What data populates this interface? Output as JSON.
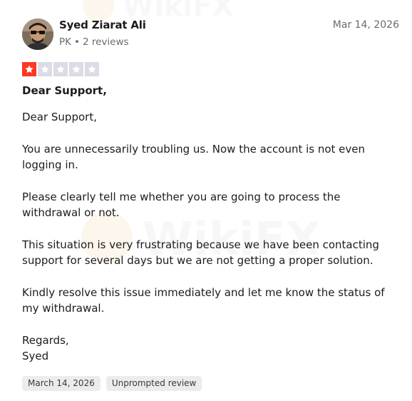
{
  "reviewer": {
    "name": "Syed Ziarat Ali",
    "country": "PK",
    "separator": "•",
    "reviews_count": "2 reviews"
  },
  "review_date": "Mar 14, 2026",
  "rating": {
    "value": 1,
    "max": 5,
    "filled_color": "#ff3722",
    "empty_color": "#dcdce6"
  },
  "review": {
    "title": "Dear Support,",
    "paragraphs": [
      "Dear Support,",
      "You are unnecessarily troubling us. Now the account is not even logging in.",
      "Please clearly tell me whether you are going to process the withdrawal or not.",
      "This situation is very frustrating because we have been contacting support for several days but we are not getting a proper solution.",
      "Kindly resolve this issue immediately and let me know the status of my withdrawal.",
      "Regards,\nSyed"
    ]
  },
  "tags": {
    "experience_date": "March 14, 2026",
    "review_type": "Unprompted review"
  },
  "watermark": {
    "text": "WikiFX"
  }
}
